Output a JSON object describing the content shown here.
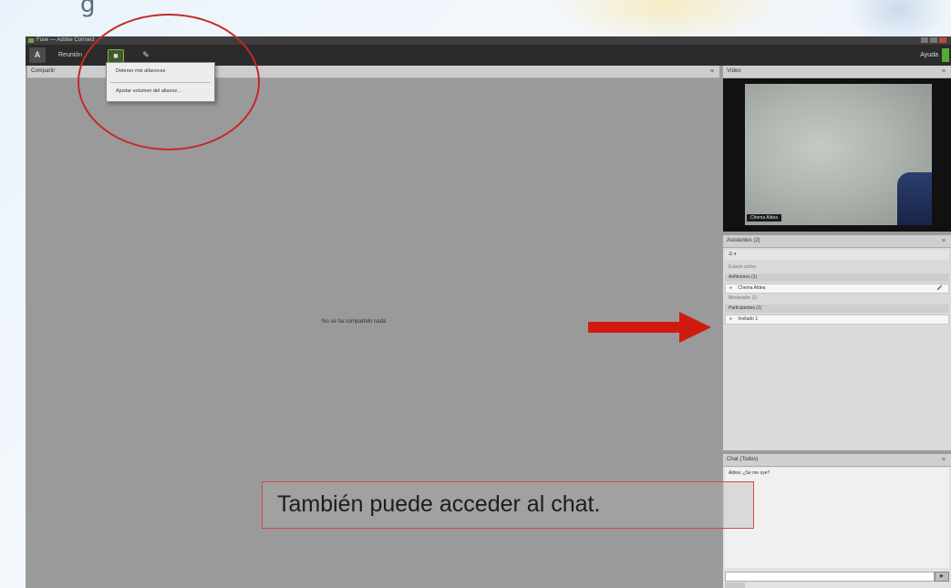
{
  "window": {
    "title": "Fuse — Adobe Connect"
  },
  "toolbar": {
    "logo": "A",
    "menu_label": "Reunión",
    "icon_webcam": "■",
    "icon_mic": "✎",
    "right_label": "Ayuda"
  },
  "dropdown_menu": {
    "items": [
      {
        "label": "Detener mis altavoces"
      },
      {
        "label": "Ajustar volumen del altavoz..."
      }
    ]
  },
  "presentation": {
    "title": "Compartir",
    "options_glyph": "≡",
    "message": "No se ha compartido nada"
  },
  "video_pod": {
    "title": "Vídeo",
    "controls": "≡",
    "user_label": "Chema Aldea"
  },
  "attendees": {
    "title": "Asistentes (2)",
    "controls": "≡",
    "tool_row": "☰ ▾",
    "status_label": "Estado activo",
    "groups": [
      {
        "label": "Anfitriones (1)",
        "members": [
          {
            "name": "Chema Aldea",
            "mic": "🎤"
          }
        ]
      },
      {
        "label": "Participantes (1)",
        "members": [
          {
            "name": "Invitado 1"
          }
        ]
      }
    ],
    "host_substatus": "Moderador (1)"
  },
  "chat": {
    "title": "Chat (Todos)",
    "controls": "≡",
    "message": "Aldea: ¿Se me oye?",
    "send_glyph": "▶"
  },
  "annotations": {
    "callout_text": "También puede acceder al chat.",
    "circle_color": "#c62828",
    "arrow_color": "#d01a10"
  }
}
